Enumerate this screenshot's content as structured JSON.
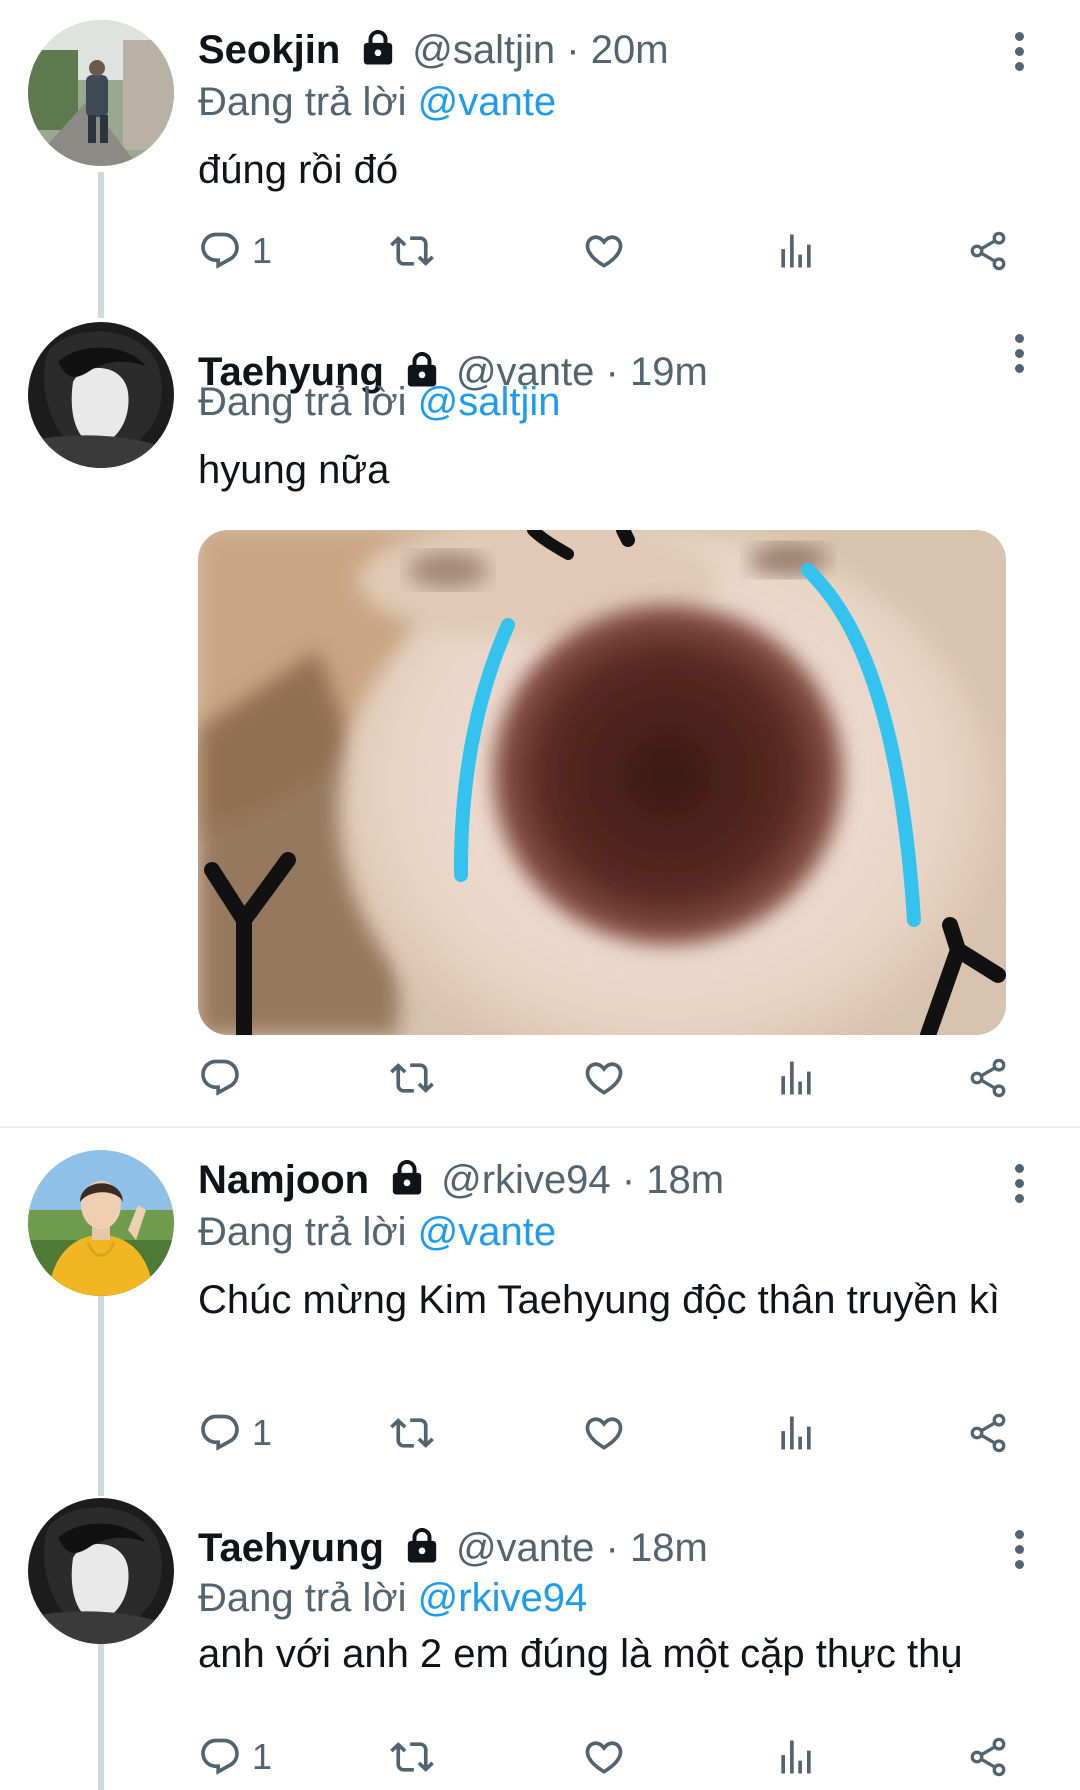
{
  "tweets": [
    {
      "name": "Seokjin",
      "handle": "@saltjin",
      "sep": "·",
      "time": "20m",
      "reply_prefix": "Đang trả lời ",
      "reply_to": "@vante",
      "text": "đúng rồi đó",
      "reply_count": "1"
    },
    {
      "name": "Taehyung",
      "handle": "@vante",
      "sep": "·",
      "time": "19m",
      "reply_prefix": "Đang trả lời ",
      "reply_to": "@saltjin",
      "text": "hyung nữa",
      "reply_count": ""
    },
    {
      "name": "Namjoon",
      "handle": "@rkive94",
      "sep": "·",
      "time": "18m",
      "reply_prefix": "Đang trả lời ",
      "reply_to": "@vante",
      "text": "Chúc mừng Kim Taehyung độc thân truyền kì",
      "reply_count": "1"
    },
    {
      "name": "Taehyung",
      "handle": "@vante",
      "sep": "·",
      "time": "18m",
      "reply_prefix": "Đang trả lời ",
      "reply_to": "@rkive94",
      "text": "anh với anh 2 em đúng là một cặp thực thụ",
      "reply_count": "1"
    }
  ],
  "icons": {
    "lock": "lock-icon",
    "more": "more-vertical-icon",
    "reply": "reply-icon",
    "retweet": "retweet-icon",
    "like": "heart-icon",
    "views": "views-icon",
    "share": "share-icon"
  },
  "colors": {
    "accent": "#1d9bf0",
    "secondary_text": "#536471",
    "thread_line": "#cfd9de",
    "tear": "#33c3ee"
  }
}
